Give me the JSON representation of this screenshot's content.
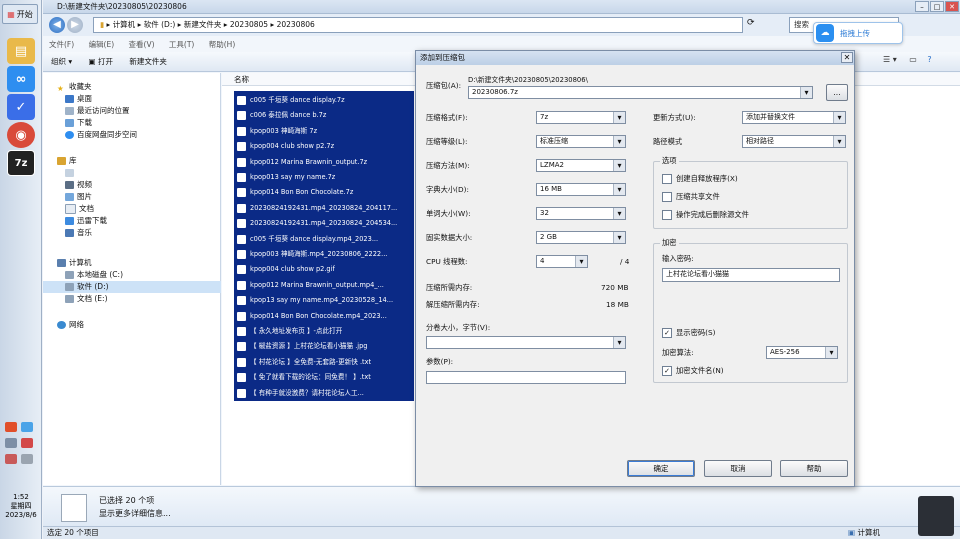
{
  "taskbar": {
    "start_label": "开始",
    "clock_time": "1:52",
    "clock_day": "星期四",
    "clock_date": "2023/8/6",
    "apps": [
      {
        "icon": "folder-icon",
        "color": "#e9b94a",
        "glyph": "▤"
      },
      {
        "icon": "baidu-netdisk-icon",
        "color": "#2e8ef0",
        "glyph": "∞"
      },
      {
        "icon": "feishu-icon",
        "color": "#3a6ee8",
        "glyph": "✓"
      },
      {
        "icon": "chrome-icon",
        "color": "#d94a3a",
        "glyph": "◉"
      },
      {
        "icon": "7zip-icon",
        "color": "#222222",
        "glyph": "7z"
      }
    ]
  },
  "explorer": {
    "title": "D:\\新建文件夹\\20230805\\20230806",
    "address": [
      "计算机",
      "软件 (D:)",
      "新建文件夹",
      "20230805",
      "20230806"
    ],
    "search_placeholder": "搜索",
    "menu": [
      "文件(F)",
      "编辑(E)",
      "查看(V)",
      "工具(T)",
      "帮助(H)"
    ],
    "toolbar": [
      "组织 ▾",
      "▣ 打开",
      "新建文件夹"
    ],
    "column_name": "名称",
    "nav": {
      "favorites": "收藏夹",
      "favorites_items": [
        "桌面",
        "最近访问的位置",
        "下载",
        "百度网盘同步空间"
      ],
      "libraries": "库",
      "library_items": [
        "视频",
        "图片",
        "文档",
        "迅雷下载",
        "音乐"
      ],
      "computer": "计算机",
      "computer_items": [
        "本地磁盘 (C:)",
        "软件 (D:)",
        "文档 (E:)"
      ],
      "network": "网络"
    },
    "files": [
      "c005 千垣葵 dance display.7z",
      "c006 泰拉佩 dance b.7z",
      "kpop003 神崎海斯 7z",
      "kpop004 club show p2.7z",
      "kpop012 Marina Brawnin_output.7z",
      "kpop013 say my name.7z",
      "kpop014 Bon Bon Chocolate.7z",
      "20230824192431.mp4_20230824_204117...",
      "20230824192431.mp4_20230824_204534...",
      "c005 千垣葵 dance display.mp4_2023...",
      "kpop003 神崎海斯.mp4_20230806_2222...",
      "kpop004 club show p2.gif",
      "kpop012 Marina Brawnin_output.mp4_...",
      "kpop13 say my name.mp4_20230528_14...",
      "kpop014 Bon Bon Chocolate.mp4_2023...",
      "【 永久地址发布页 】-点此打开",
      "【 椒盐资源 】上村花论坛看小猫猫 .jpg",
      "【 村花论坛 】全免费-无套路-更新快 .txt",
      "【 免了就看下载的论坛：同免费！ 】.txt",
      "【 有种手就没激费？请村花论坛人工..."
    ],
    "details": {
      "selected": "已选择 20 个项",
      "more": "显示更多详细信息..."
    },
    "status": "选定 20 个项目",
    "status_right": "计算机",
    "upload_popup": "拖拽上传"
  },
  "dialog": {
    "title": "添加到压缩包",
    "archive_label": "压缩包(A):",
    "archive_path": "D:\\新建文件夹\\20230805\\20230806\\",
    "archive_name": "20230806.7z",
    "browse": "...",
    "format_label": "压缩格式(F):",
    "format_value": "7z",
    "level_label": "压缩等级(L):",
    "level_value": "标准压缩",
    "method_label": "压缩方法(M):",
    "method_value": "LZMA2",
    "dict_label": "字典大小(D):",
    "dict_value": "16 MB",
    "word_label": "单词大小(W):",
    "word_value": "32",
    "solid_label": "固实数据大小:",
    "solid_value": "2 GB",
    "cpu_label": "CPU 线程数:",
    "cpu_value": "4",
    "cpu_total": "/ 4",
    "mem_comp_label": "压缩所需内存:",
    "mem_comp_value": "720 MB",
    "mem_decomp_label": "解压缩所需内存:",
    "mem_decomp_value": "18 MB",
    "split_label": "分卷大小，字节(V):",
    "params_label": "参数(P):",
    "update_label": "更新方式(U):",
    "update_value": "添加并替换文件",
    "path_label": "路径模式",
    "path_value": "相对路径",
    "options_title": "选项",
    "opt_sfx": "创建自释放程序(X)",
    "opt_shared": "压缩共享文件",
    "opt_delete": "操作完成后删除源文件",
    "enc_title": "加密",
    "enc_prompt": "输入密码:",
    "password": "上村花论坛看小猫猫",
    "show_password": "显示密码(S)",
    "enc_method_label": "加密算法:",
    "enc_method_value": "AES-256",
    "encrypt_names": "加密文件名(N)",
    "ok": "确定",
    "cancel": "取消",
    "help": "帮助"
  }
}
